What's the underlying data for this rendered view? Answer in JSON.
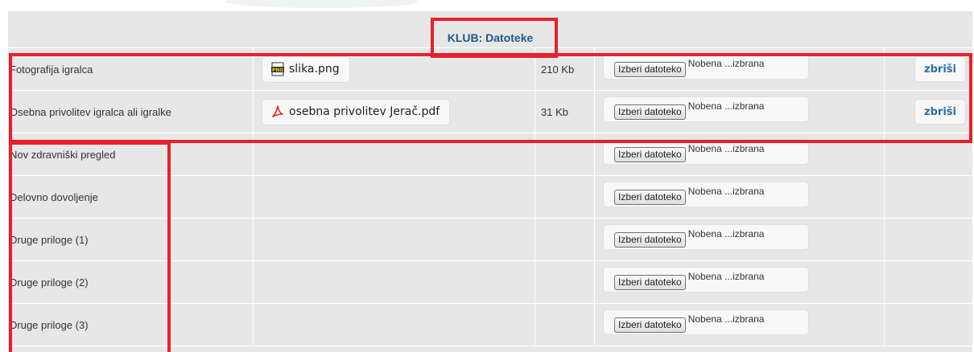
{
  "section": {
    "title": "KLUB: Datoteke"
  },
  "rows": [
    {
      "label": "Fotografija igralca",
      "file": {
        "name": "slika.png",
        "icon": "png-file-icon"
      },
      "size": "210 Kb",
      "upload": {
        "button": "Izberi datoteko",
        "status": "Nobena ...izbrana"
      },
      "delete": "zbriši"
    },
    {
      "label": "Osebna privolitev igralca ali igralke",
      "file": {
        "name": "osebna privolitev Jerač.pdf",
        "icon": "pdf-file-icon"
      },
      "size": "31 Kb",
      "upload": {
        "button": "Izberi datoteko",
        "status": "Nobena ...izbrana"
      },
      "delete": "zbriši"
    },
    {
      "label": "Nov zdravniški pregled",
      "upload": {
        "button": "Izberi datoteko",
        "status": "Nobena ...izbrana"
      }
    },
    {
      "label": "Delovno dovoljenje",
      "upload": {
        "button": "Izberi datoteko",
        "status": "Nobena ...izbrana"
      }
    },
    {
      "label": "Druge priloge (1)",
      "upload": {
        "button": "Izberi datoteko",
        "status": "Nobena ...izbrana"
      }
    },
    {
      "label": "Druge priloge (2)",
      "upload": {
        "button": "Izberi datoteko",
        "status": "Nobena ...izbrana"
      }
    },
    {
      "label": "Druge priloge (3)",
      "upload": {
        "button": "Izberi datoteko",
        "status": "Nobena ...izbrana"
      }
    }
  ],
  "colors": {
    "table_bg": "#e7e7e7",
    "title": "#1f5a8a",
    "delete_link": "#2a6ea8",
    "highlight": "#e8202a"
  }
}
